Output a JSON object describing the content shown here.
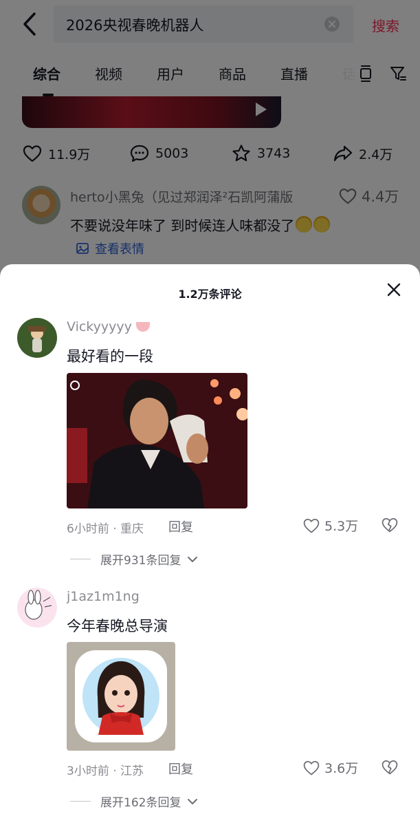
{
  "header": {
    "search_query": "2026央视春晚机器人",
    "search_button": "搜索"
  },
  "tabs": [
    {
      "label": "综合",
      "active": true
    },
    {
      "label": "视频",
      "active": false
    },
    {
      "label": "用户",
      "active": false
    },
    {
      "label": "商品",
      "active": false
    },
    {
      "label": "直播",
      "active": false
    },
    {
      "label": "话",
      "active": false
    }
  ],
  "post_stats": {
    "likes": "11.9万",
    "comments": "5003",
    "favorites": "3743",
    "shares": "2.4万"
  },
  "preview_comment": {
    "username": "herto小黑兔（见过郑润泽²石凯阿蒲版",
    "likes": "4.4万",
    "text": "不要说没年味了 到时候连人味都没了",
    "sticker_link": "查看表情"
  },
  "sheet": {
    "title": "1.2万条评论"
  },
  "comments": [
    {
      "username": "Vickyyyyy",
      "text": "最好看的一段",
      "meta": "6小时前 · 重庆",
      "reply": "回复",
      "likes": "5.3万",
      "expand": "展开931条回复"
    },
    {
      "username": "j1az1m1ng",
      "text": "今年春晚总导演",
      "meta": "3小时前 · 江苏",
      "reply": "回复",
      "likes": "3.6万",
      "expand": "展开162条回复"
    }
  ],
  "colors": {
    "accent": "#fe2c55",
    "link": "#2c61d6",
    "overlay": "rgba(0,0,0,0.5)"
  }
}
